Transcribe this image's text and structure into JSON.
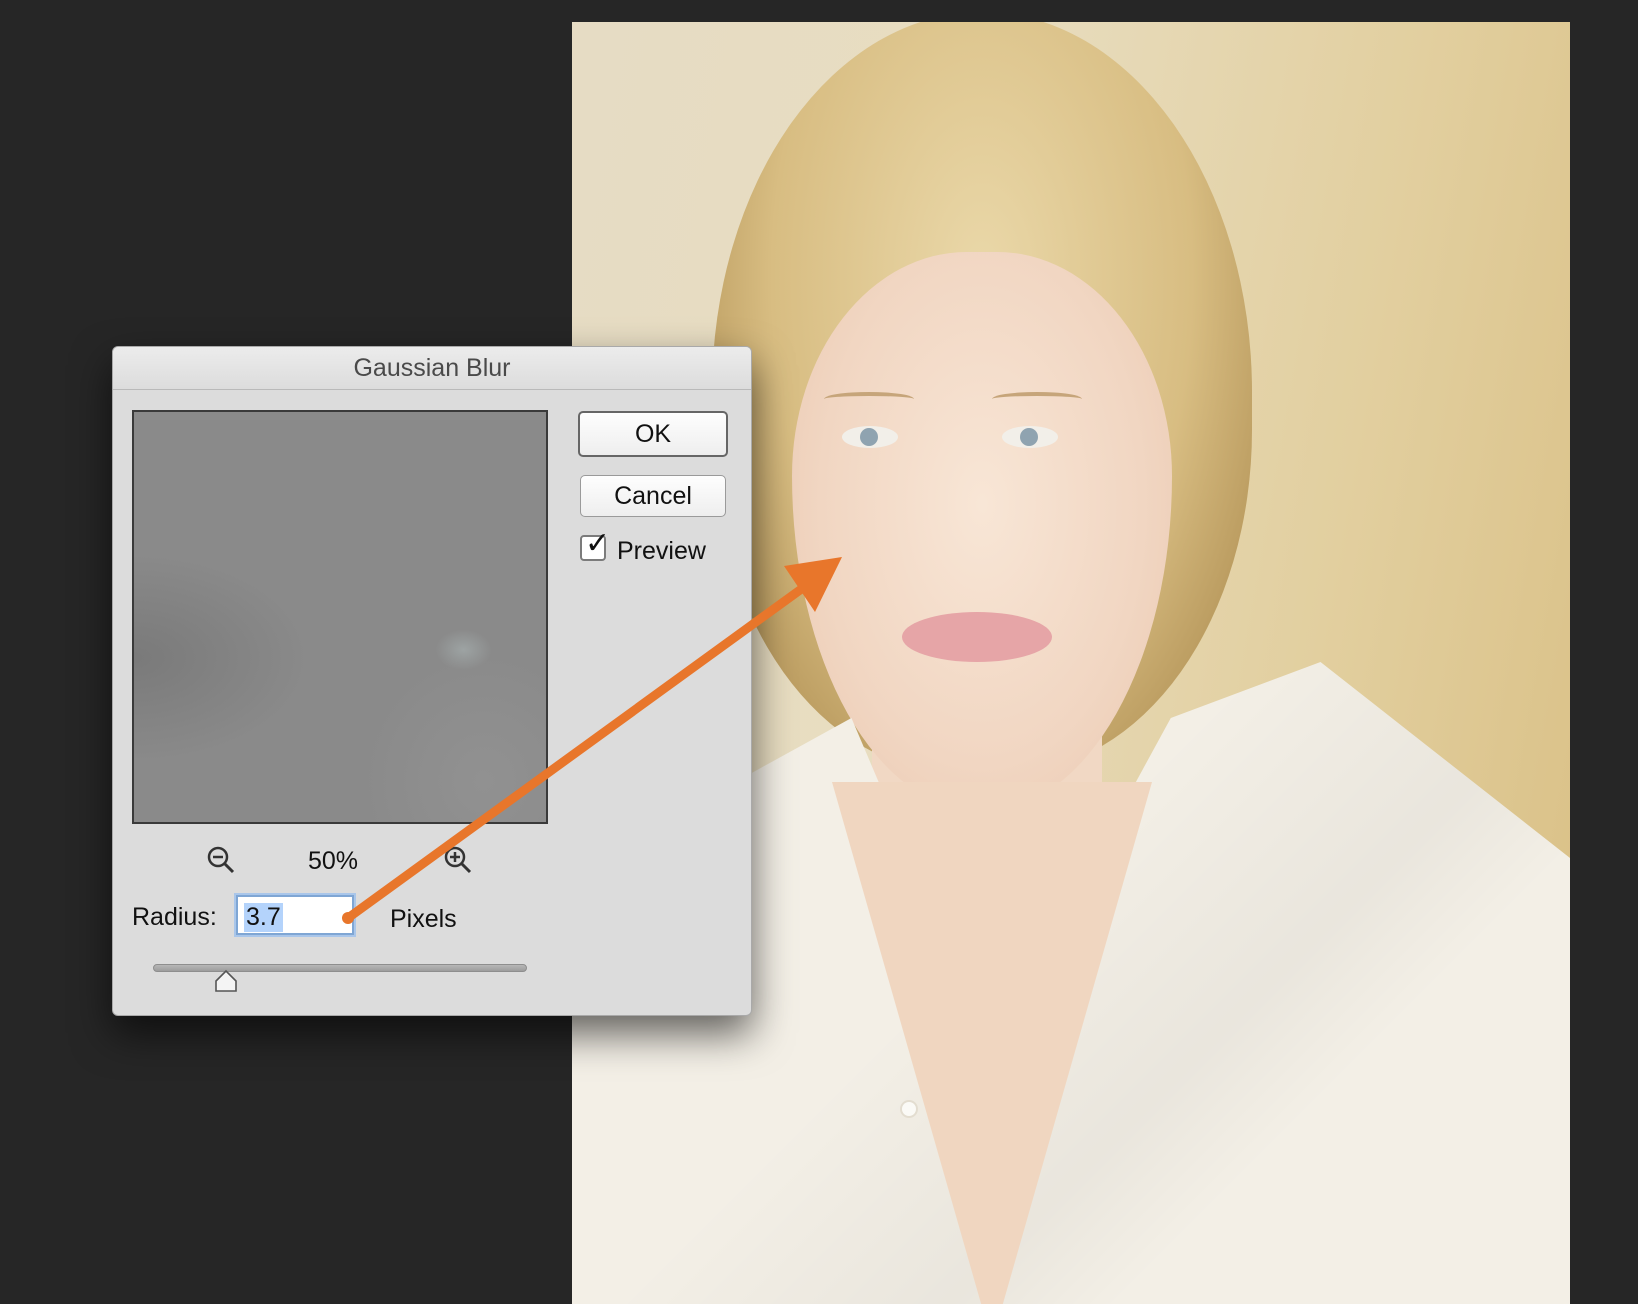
{
  "dialog": {
    "title": "Gaussian Blur",
    "ok_label": "OK",
    "cancel_label": "Cancel",
    "preview_label": "Preview",
    "preview_checked": true,
    "zoom_level": "50%",
    "radius_label": "Radius:",
    "radius_value": "3.7",
    "radius_unit": "Pixels"
  },
  "icons": {
    "zoom_out": "zoom-out-icon",
    "zoom_in": "zoom-in-icon",
    "checkmark": "checkmark-icon"
  },
  "colors": {
    "annotation_arrow": "#e8762b",
    "input_selection": "#b4d3fb",
    "background": "#262626"
  }
}
